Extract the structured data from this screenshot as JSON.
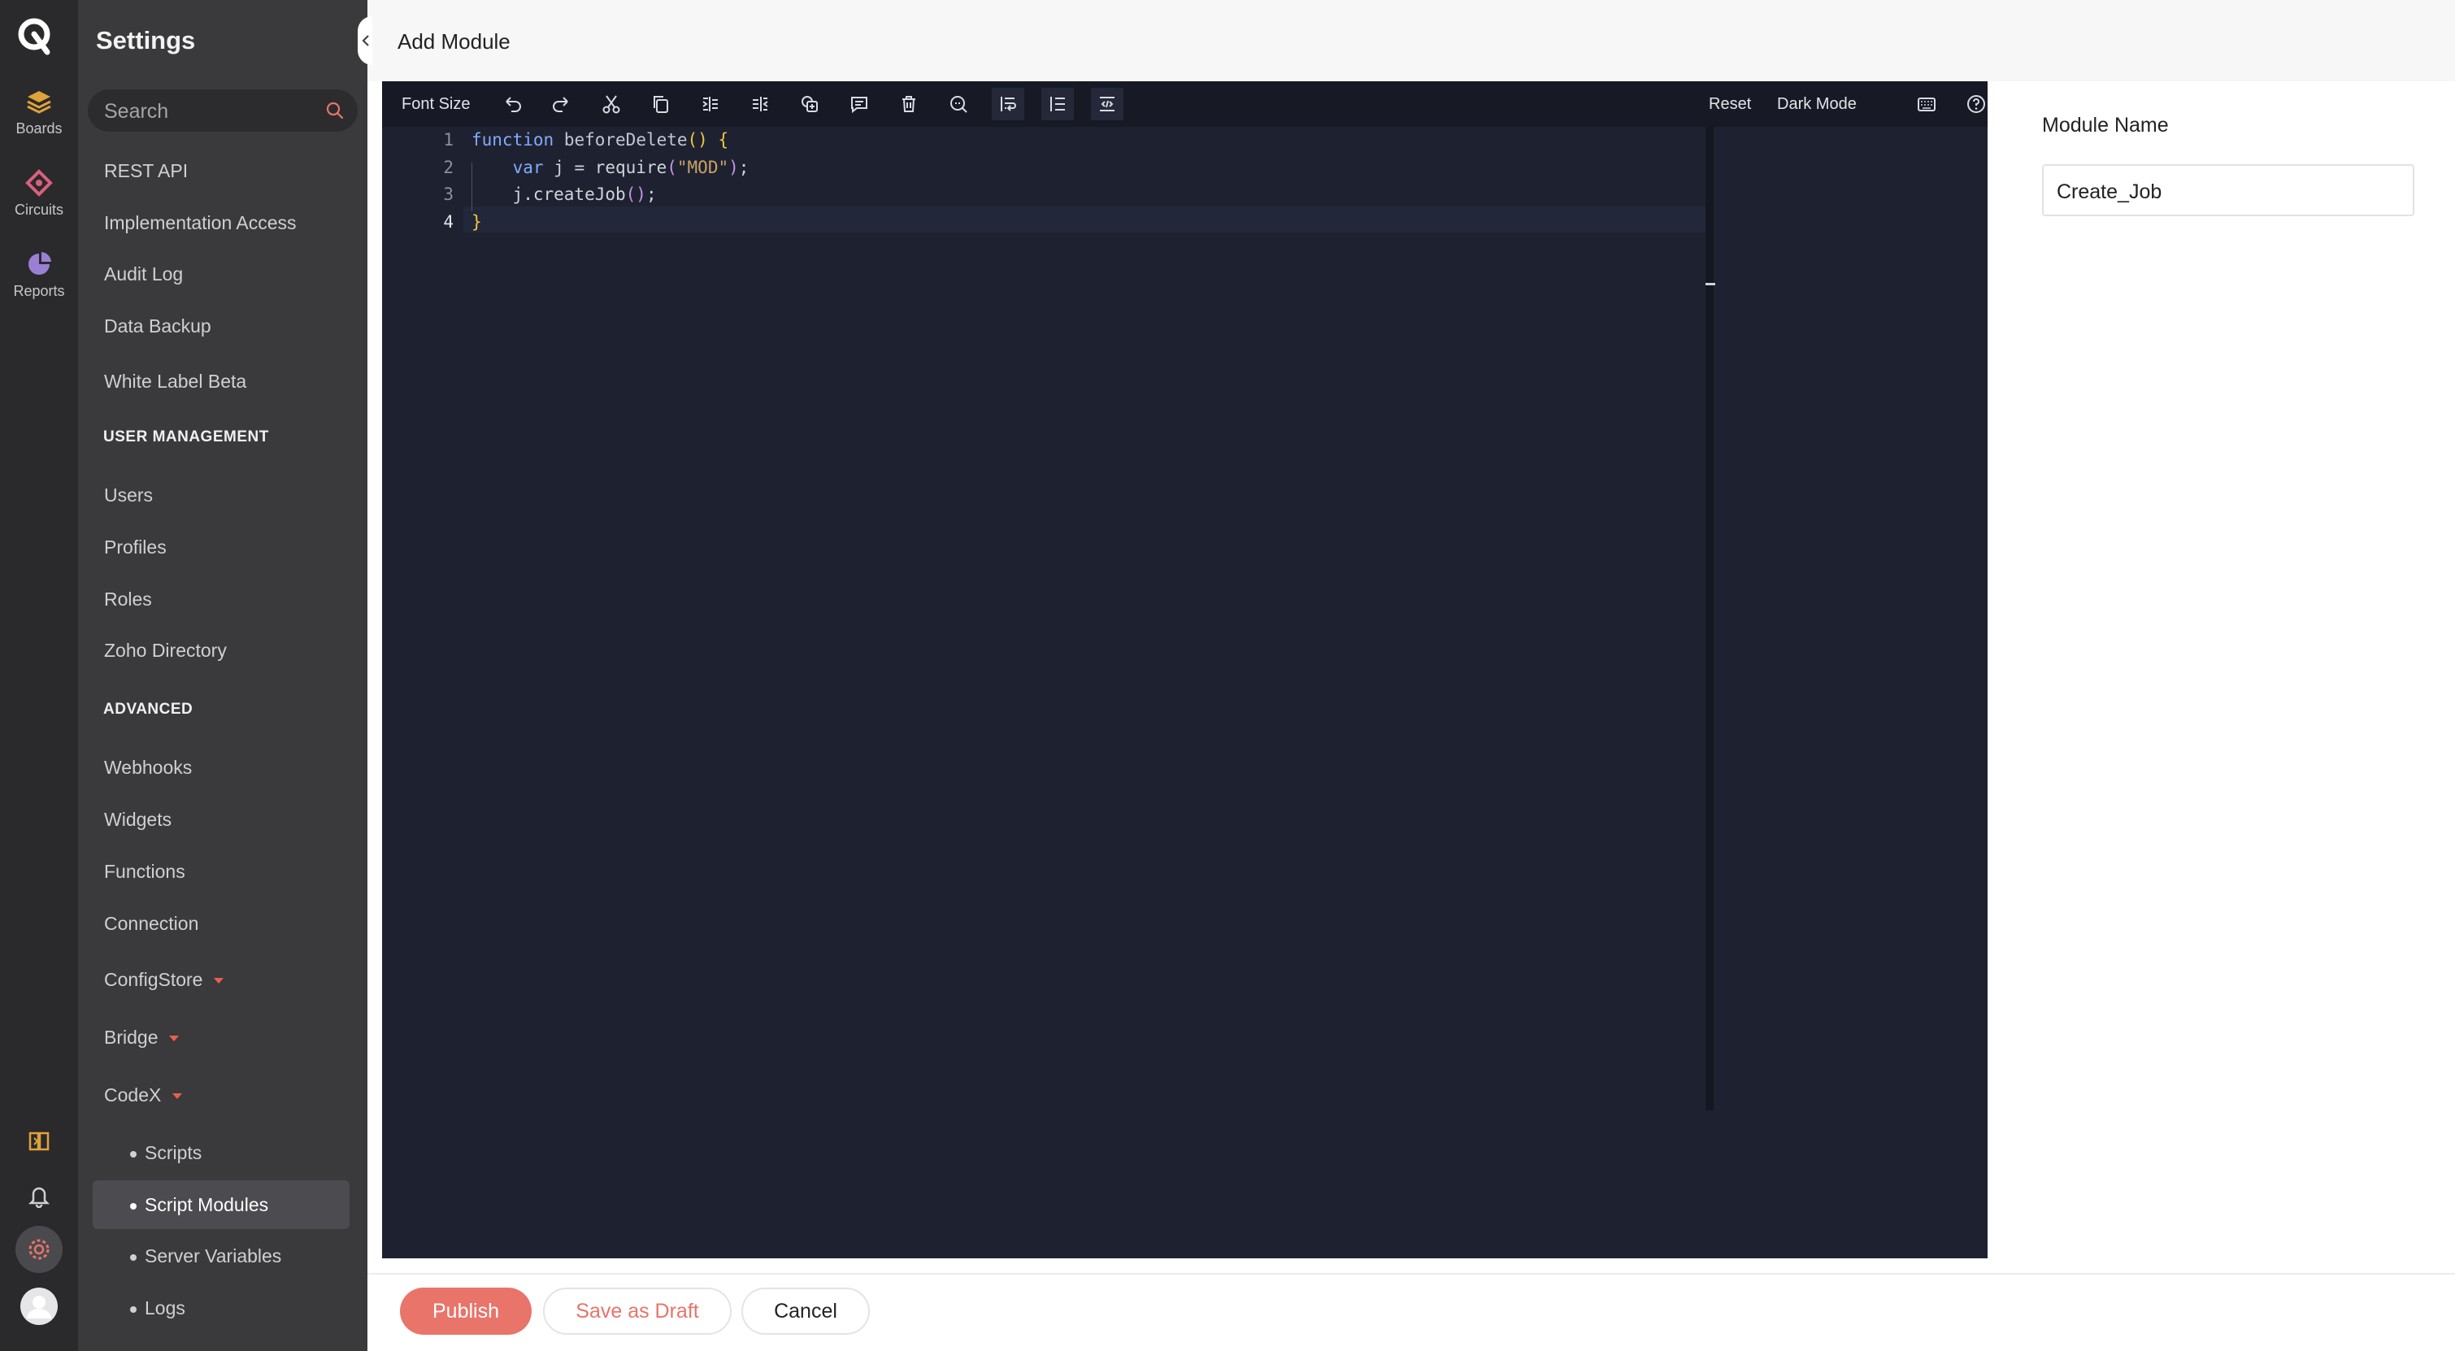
{
  "rail": {
    "items": [
      {
        "label": "Boards",
        "icon": "boards-icon"
      },
      {
        "label": "Circuits",
        "icon": "circuits-icon"
      },
      {
        "label": "Reports",
        "icon": "reports-icon"
      }
    ]
  },
  "sidebar": {
    "title": "Settings",
    "search_placeholder": "Search",
    "items": [
      "REST API",
      "Implementation Access",
      "Audit Log",
      "Data Backup",
      "White Label Beta"
    ],
    "section_user": "USER MANAGEMENT",
    "user_items": [
      "Users",
      "Profiles",
      "Roles",
      "Zoho Directory"
    ],
    "section_advanced": "ADVANCED",
    "advanced_items": [
      "Webhooks",
      "Widgets",
      "Functions",
      "Connection"
    ],
    "expandable": [
      "ConfigStore",
      "Bridge",
      "CodeX"
    ],
    "codex_items": [
      "Scripts",
      "Script Modules",
      "Server Variables",
      "Logs"
    ],
    "active_item": "Script Modules"
  },
  "header": {
    "title": "Add Module"
  },
  "toolbar": {
    "font_size": "Font Size",
    "reset": "Reset",
    "dark_mode": "Dark Mode"
  },
  "editor": {
    "line_numbers": [
      "1",
      "2",
      "3",
      "4"
    ]
  },
  "panel": {
    "module_name_label": "Module Name",
    "module_name_value": "Create_Job"
  },
  "footer": {
    "publish": "Publish",
    "save_draft": "Save as Draft",
    "cancel": "Cancel"
  },
  "colors": {
    "accent": "#e8746a",
    "editor_bg": "#1e2230",
    "sidebar_bg": "#3a3a3d",
    "rail_bg": "#2a2a2c"
  }
}
